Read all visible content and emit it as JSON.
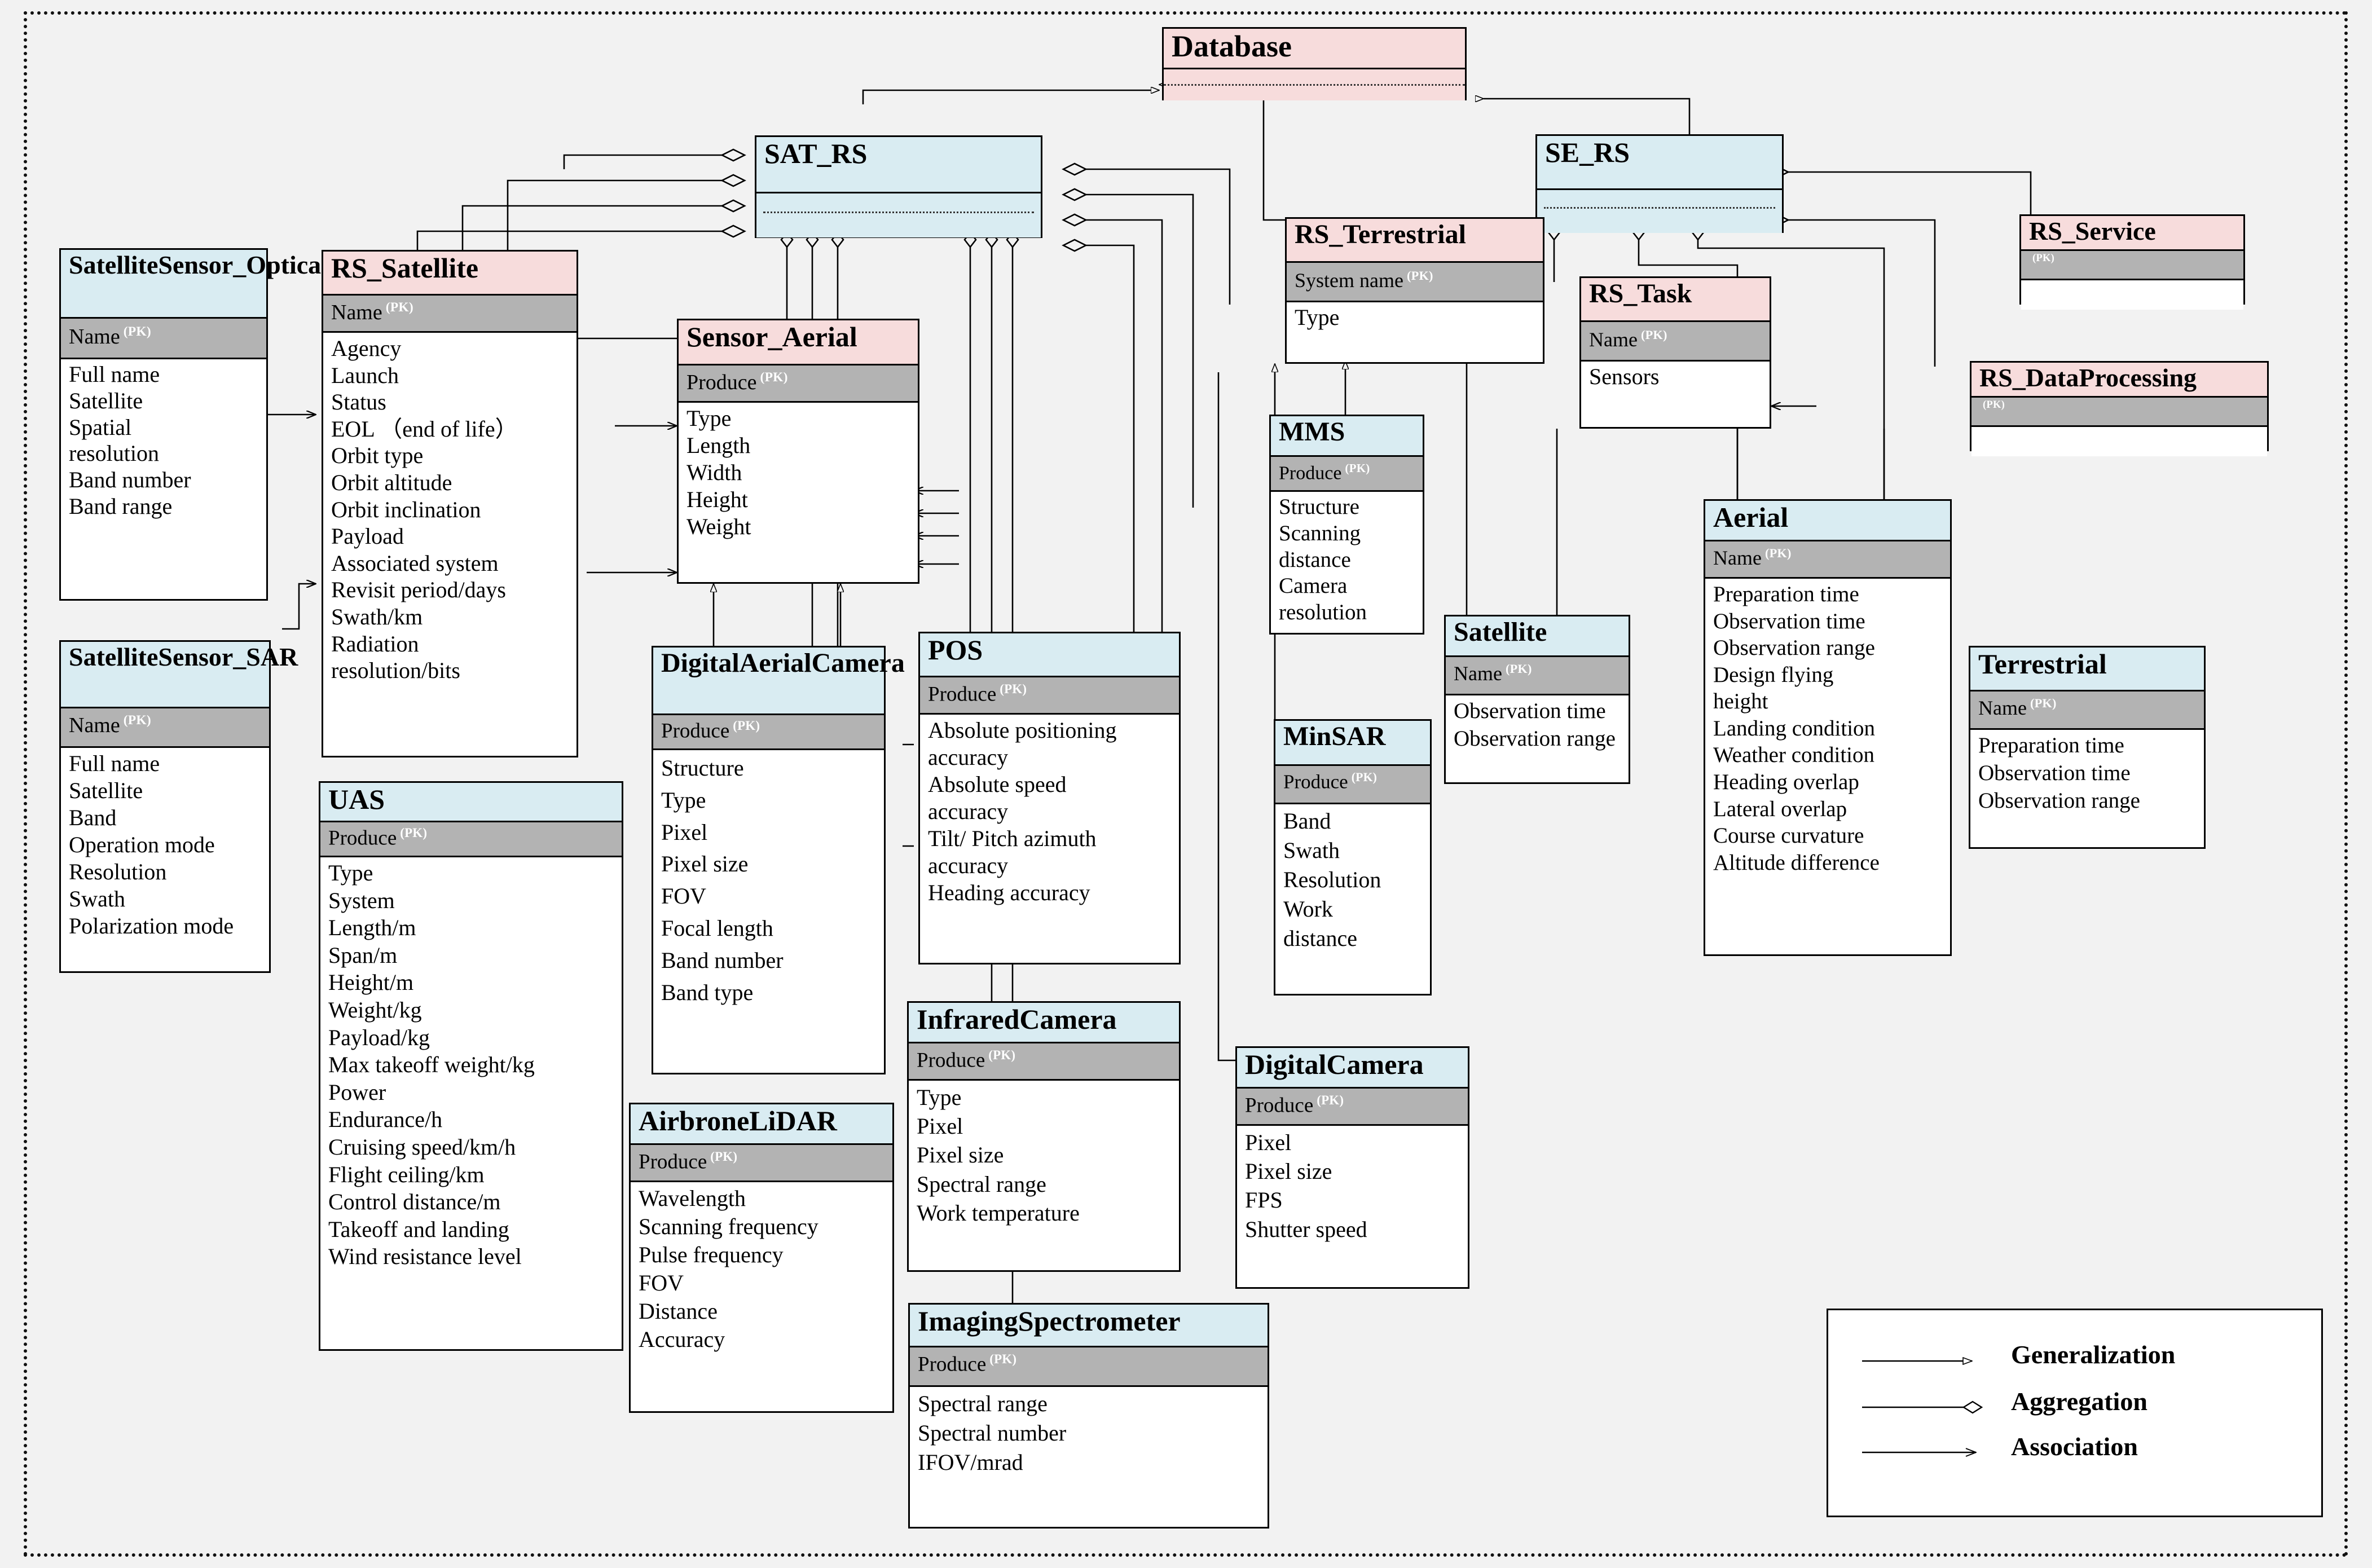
{
  "diagram": {
    "title_legend": {
      "items": [
        {
          "id": "generalization",
          "label": "Generalization",
          "marker": "hollow-triangle-arrow"
        },
        {
          "id": "aggregation",
          "label": "Aggregation",
          "marker": "hollow-diamond"
        },
        {
          "id": "association",
          "label": "Association",
          "marker": "open-arrow"
        }
      ]
    },
    "colors": {
      "header_blue": "#d9ecf2",
      "header_pink": "#f7dcdc",
      "pk_band_gray": "#b3b3b3",
      "canvas_gray": "#f2f2f2",
      "line_black": "#000000"
    },
    "pk_suffix": "(PK)",
    "entities": [
      {
        "id": "database",
        "name": "Database",
        "header_color": "pink",
        "pk": "",
        "attributes": [],
        "has_dashed_divider": true
      },
      {
        "id": "sat_rs",
        "name": "SAT_RS",
        "header_color": "blue",
        "pk": "",
        "attributes": [],
        "has_dashed_divider": true
      },
      {
        "id": "se_rs",
        "name": "SE_RS",
        "header_color": "blue",
        "pk": "",
        "attributes": [],
        "has_dashed_divider": true
      },
      {
        "id": "rs_service",
        "name": "RS_Service",
        "header_color": "pink",
        "pk": "",
        "attributes": []
      },
      {
        "id": "rs_dataprocessing",
        "name": "RS_DataProcessing",
        "header_color": "pink",
        "pk": "",
        "attributes": []
      },
      {
        "id": "satellitesensor_optical",
        "name": "SatelliteSensor_Optical",
        "header_color": "blue",
        "pk": "Name",
        "attributes": [
          "Full name",
          "Satellite",
          "Spatial",
          "resolution",
          "Band number",
          "Band range"
        ]
      },
      {
        "id": "rs_satellite",
        "name": "RS_Satellite",
        "header_color": "pink",
        "pk": "Name",
        "attributes": [
          "Agency",
          "Launch",
          "Status",
          "EOL （end of life）",
          "Orbit type",
          "Orbit altitude",
          "Orbit inclination",
          "Payload",
          "Associated system",
          "Revisit period/days",
          "Swath/km",
          "Radiation",
          "resolution/bits"
        ]
      },
      {
        "id": "sensor_aerial",
        "name": "Sensor_Aerial",
        "header_color": "pink",
        "pk": "Produce",
        "attributes": [
          "Type",
          "Length",
          "Width",
          "Height",
          "Weight"
        ]
      },
      {
        "id": "rs_terrestrial",
        "name": "RS_Terrestrial",
        "header_color": "pink",
        "pk": "System name",
        "attributes": [
          "Type"
        ]
      },
      {
        "id": "rs_task",
        "name": "RS_Task",
        "header_color": "pink",
        "pk": "Name",
        "attributes": [
          "Sensors"
        ]
      },
      {
        "id": "mms",
        "name": "MMS",
        "header_color": "blue",
        "pk": "Produce",
        "attributes": [
          "Structure",
          "Scanning",
          "distance",
          "Camera",
          "resolution"
        ]
      },
      {
        "id": "satellitesensor_sar",
        "name": "SatelliteSensor_SAR",
        "header_color": "blue",
        "pk": "Name",
        "attributes": [
          "Full name",
          "Satellite",
          "Band",
          "Operation mode",
          "Resolution",
          "Swath",
          "Polarization mode"
        ]
      },
      {
        "id": "uas",
        "name": "UAS",
        "header_color": "blue",
        "pk": "Produce",
        "attributes": [
          "Type",
          "System",
          "Length/m",
          "Span/m",
          "Height/m",
          "Weight/kg",
          "Payload/kg",
          "Max takeoff weight/kg",
          "Power",
          "Endurance/h",
          "Cruising speed/km/h",
          "Flight ceiling/km",
          "Control distance/m",
          "Takeoff and landing",
          "Wind resistance level"
        ]
      },
      {
        "id": "digitalaerialcamera",
        "name": "DigitalAerialCamera",
        "header_color": "blue",
        "pk": "Produce",
        "attributes": [
          "Structure",
          "Type",
          "Pixel",
          "Pixel size",
          "FOV",
          "Focal length",
          "Band number",
          "Band type"
        ]
      },
      {
        "id": "pos",
        "name": "POS",
        "header_color": "blue",
        "pk": "Produce",
        "attributes": [
          "Absolute positioning",
          "accuracy",
          "Absolute speed",
          "accuracy",
          "Tilt/ Pitch azimuth",
          "accuracy",
          "Heading accuracy"
        ]
      },
      {
        "id": "minsar",
        "name": "MinSAR",
        "header_color": "blue",
        "pk": "Produce",
        "attributes": [
          "Band",
          "Swath",
          "Resolution",
          "Work",
          "distance"
        ]
      },
      {
        "id": "satellite",
        "name": "Satellite",
        "header_color": "blue",
        "pk": "Name",
        "attributes": [
          "Observation time",
          "Observation range"
        ]
      },
      {
        "id": "aerial",
        "name": "Aerial",
        "header_color": "blue",
        "pk": "Name",
        "attributes": [
          "Preparation time",
          "Observation time",
          "Observation range",
          "Design flying",
          "height",
          "Landing condition",
          "Weather condition",
          "Heading overlap",
          "Lateral overlap",
          "Course curvature",
          "Altitude difference"
        ]
      },
      {
        "id": "terrestrial",
        "name": "Terrestrial",
        "header_color": "blue",
        "pk": "Name",
        "attributes": [
          "Preparation time",
          "Observation time",
          "Observation range"
        ]
      },
      {
        "id": "infraredcamera",
        "name": "InfraredCamera",
        "header_color": "blue",
        "pk": "Produce",
        "attributes": [
          "Type",
          "Pixel",
          "Pixel size",
          "Spectral range",
          "Work temperature"
        ]
      },
      {
        "id": "digitalcamera",
        "name": "DigitalCamera",
        "header_color": "blue",
        "pk": "Produce",
        "attributes": [
          "Pixel",
          "Pixel size",
          "FPS",
          "Shutter speed"
        ]
      },
      {
        "id": "airbronelidar",
        "name": "AirbroneLiDAR",
        "header_color": "blue",
        "pk": "Produce",
        "attributes": [
          "Wavelength",
          "Scanning frequency",
          "Pulse frequency",
          "FOV",
          "Distance",
          "Accuracy"
        ]
      },
      {
        "id": "imagingspectrometer",
        "name": "ImagingSpectrometer",
        "header_color": "blue",
        "pk": "Produce",
        "attributes": [
          "Spectral range",
          "Spectral number",
          "IFOV/mrad"
        ]
      }
    ]
  }
}
